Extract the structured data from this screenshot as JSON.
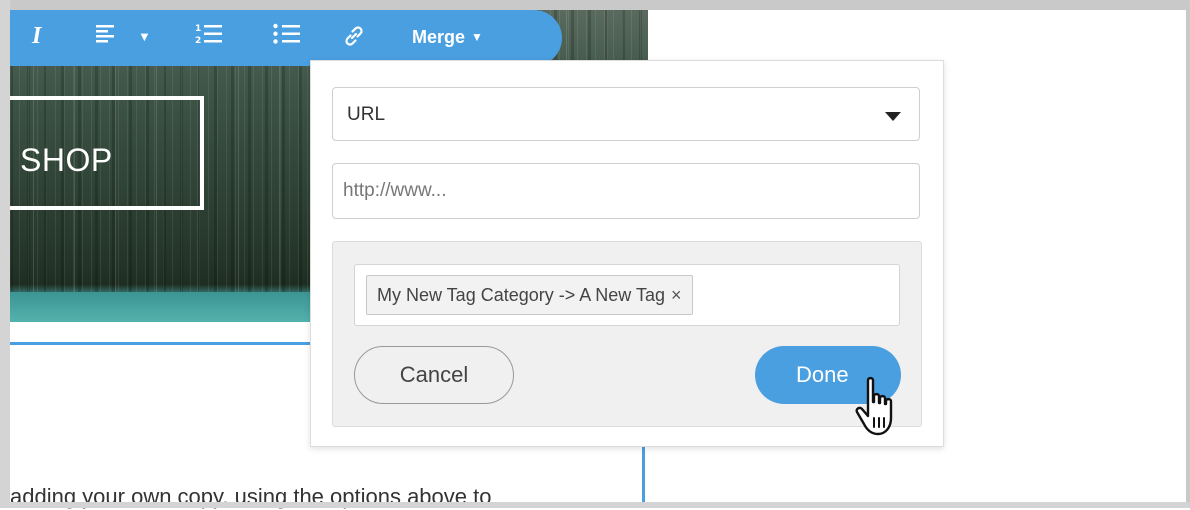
{
  "toolbar": {
    "italic_label": "I",
    "align_icon": "align-left-icon",
    "ordered_list_icon": "ordered-list-icon",
    "unordered_list_icon": "unordered-list-icon",
    "link_icon": "link-icon",
    "merge_label": "Merge",
    "accent_color": "#4a9fe0"
  },
  "hero": {
    "button_text": "SHOP"
  },
  "editor": {
    "body_text": "adding your own copy, using the options above to"
  },
  "link_popup": {
    "link_type": {
      "selected": "URL"
    },
    "url_input": {
      "value": "",
      "placeholder": "http://www..."
    },
    "tags": [
      {
        "label": "My New Tag Category -> A New Tag",
        "remove_glyph": "×"
      }
    ],
    "cancel_label": "Cancel",
    "done_label": "Done"
  },
  "cursor": {
    "icon": "hand-pointer-icon"
  }
}
